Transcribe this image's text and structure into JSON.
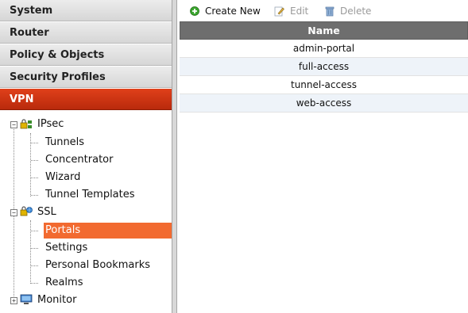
{
  "sidebar": {
    "categories": [
      {
        "label": "System"
      },
      {
        "label": "Router"
      },
      {
        "label": "Policy & Objects"
      },
      {
        "label": "Security Profiles"
      },
      {
        "label": "VPN"
      }
    ],
    "tree": {
      "ipsec": {
        "label": "IPsec",
        "children": [
          "Tunnels",
          "Concentrator",
          "Wizard",
          "Tunnel Templates"
        ]
      },
      "ssl": {
        "label": "SSL",
        "children": [
          "Portals",
          "Settings",
          "Personal Bookmarks",
          "Realms"
        ]
      },
      "monitor": {
        "label": "Monitor"
      }
    },
    "toggle_expanded": "−",
    "toggle_collapsed": "+"
  },
  "toolbar": {
    "create_new": "Create New",
    "edit": "Edit",
    "delete": "Delete"
  },
  "table": {
    "header": "Name",
    "rows": [
      "admin-portal",
      "full-access",
      "tunnel-access",
      "web-access"
    ]
  },
  "colors": {
    "active_category": "#c83213",
    "selected_item": "#f26a30",
    "table_header": "#6e6e6e",
    "row_alt": "#eef3f9"
  },
  "icons": {
    "create_new": "green-plus-circle-icon",
    "edit": "pencil-edit-icon",
    "delete": "trash-can-icon",
    "ipsec": "lock-network-icon",
    "ssl": "lock-globe-icon",
    "monitor": "monitor-screen-icon"
  }
}
